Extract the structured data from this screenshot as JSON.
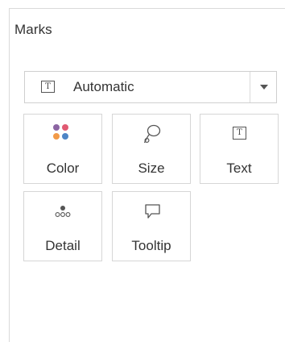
{
  "marks_card": {
    "title": "Marks",
    "mark_type": {
      "value": "Automatic",
      "icon": "text-mark-icon",
      "icon_glyph": "T",
      "dropdown_icon": "chevron-down-icon"
    },
    "shelves": [
      {
        "id": "color",
        "label": "Color",
        "icon": "color-dots-icon"
      },
      {
        "id": "size",
        "label": "Size",
        "icon": "size-lasso-icon"
      },
      {
        "id": "text",
        "label": "Text",
        "icon": "text-box-icon",
        "icon_glyph": "T"
      },
      {
        "id": "detail",
        "label": "Detail",
        "icon": "detail-dots-icon"
      },
      {
        "id": "tooltip",
        "label": "Tooltip",
        "icon": "speech-bubble-icon"
      }
    ]
  },
  "colors": {
    "color_icon_dots": [
      "#8c65a3",
      "#e15a72",
      "#f29a48",
      "#4e85c6"
    ],
    "border": "#d6d6d6",
    "text": "#333333"
  }
}
